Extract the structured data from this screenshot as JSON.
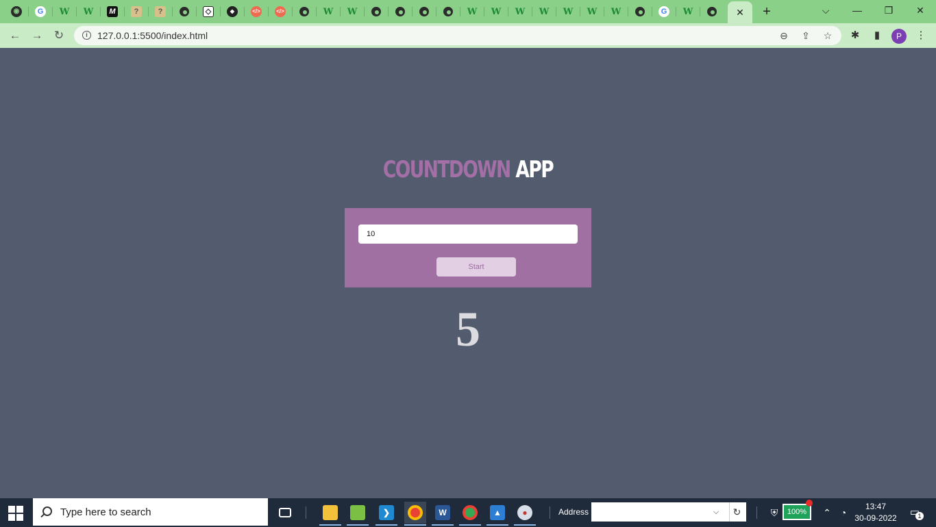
{
  "browser": {
    "tabs": [
      {
        "icon": "github-icon",
        "glyph": "◉"
      },
      {
        "icon": "google-icon",
        "glyph": "G"
      },
      {
        "icon": "w-icon",
        "glyph": "W"
      },
      {
        "icon": "w-icon",
        "glyph": "W"
      },
      {
        "icon": "m-icon",
        "glyph": "M"
      },
      {
        "icon": "question-icon",
        "glyph": "?"
      },
      {
        "icon": "question-icon",
        "glyph": "?"
      },
      {
        "icon": "globe-icon",
        "glyph": ""
      },
      {
        "icon": "codepen-icon",
        "glyph": "◇"
      },
      {
        "icon": "code-diamond-icon",
        "glyph": "◆"
      },
      {
        "icon": "code-icon",
        "glyph": "</>"
      },
      {
        "icon": "code-icon",
        "glyph": "</>"
      },
      {
        "icon": "globe-icon",
        "glyph": ""
      },
      {
        "icon": "w-icon",
        "glyph": "W"
      },
      {
        "icon": "w-icon",
        "glyph": "W"
      },
      {
        "icon": "globe-icon",
        "glyph": ""
      },
      {
        "icon": "globe-icon",
        "glyph": ""
      },
      {
        "icon": "globe-icon",
        "glyph": ""
      },
      {
        "icon": "globe-icon",
        "glyph": ""
      },
      {
        "icon": "w-icon",
        "glyph": "W"
      },
      {
        "icon": "w-icon",
        "glyph": "W"
      },
      {
        "icon": "w-icon",
        "glyph": "W"
      },
      {
        "icon": "w-icon",
        "glyph": "W"
      },
      {
        "icon": "w-icon",
        "glyph": "W"
      },
      {
        "icon": "w-icon",
        "glyph": "W"
      },
      {
        "icon": "w-icon",
        "glyph": "W"
      },
      {
        "icon": "globe-icon",
        "glyph": ""
      },
      {
        "icon": "google-icon",
        "glyph": "G"
      },
      {
        "icon": "w-icon",
        "glyph": "W"
      },
      {
        "icon": "globe-icon",
        "glyph": ""
      }
    ],
    "active_tab_close": "✕",
    "new_tab": "+",
    "window_controls": {
      "tab_search": "⌵",
      "minimize": "—",
      "restore": "❐",
      "close": "✕"
    },
    "nav": {
      "back": "←",
      "forward": "→",
      "reload": "↻"
    },
    "url": "127.0.0.1:5500/index.html",
    "profile_initial": "P",
    "toolbar_icons": {
      "zoom": "⊖",
      "share": "⇪",
      "bookmark": "☆",
      "extensions": "✱",
      "sidepanel": "▮",
      "menu": "⋮"
    }
  },
  "page": {
    "title_part1": "COUNTDOWN",
    "title_part2": "APP",
    "input_value": "10",
    "start_label": "Start",
    "counter": "5"
  },
  "taskbar": {
    "search_placeholder": "Type here to search",
    "address_label": "Address",
    "battery": "100%",
    "time": "13:47",
    "date": "30-09-2022",
    "notification_count": "1"
  },
  "colors": {
    "page_bg": "#525c6e",
    "card_bg": "#a070a3",
    "title_accent": "#a36fa6",
    "tabstrip": "#8bd089"
  }
}
